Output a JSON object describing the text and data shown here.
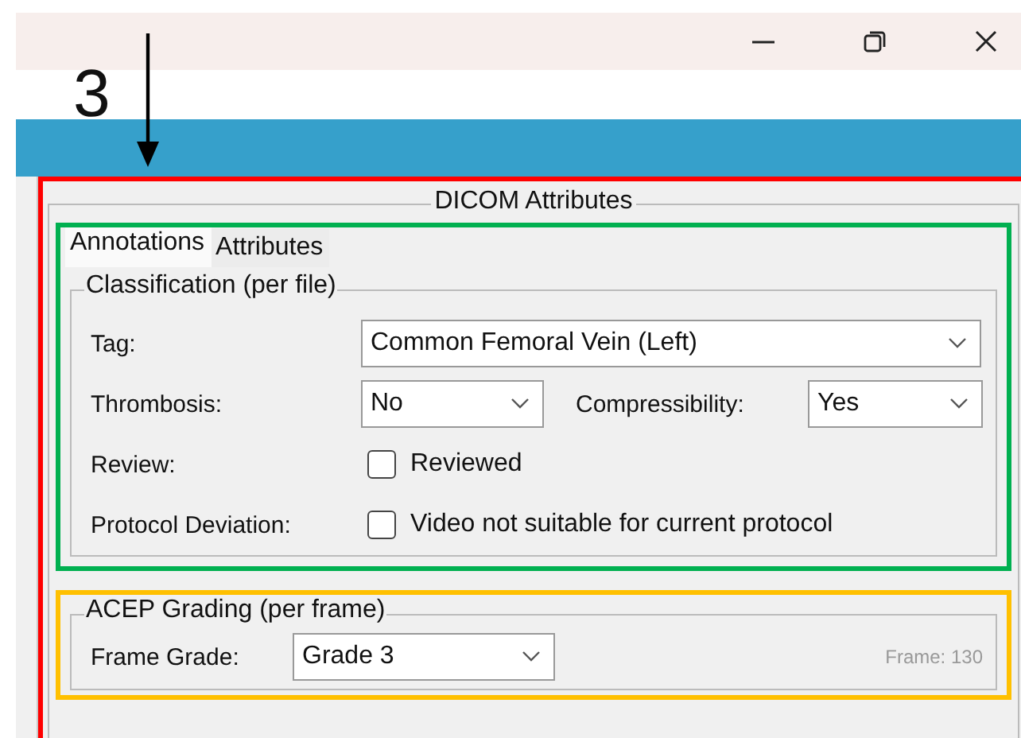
{
  "callout": {
    "label": "3"
  },
  "window": {
    "controls": [
      {
        "kind": "minimize"
      },
      {
        "kind": "restore"
      },
      {
        "kind": "close"
      }
    ]
  },
  "panel": {
    "title": "DICOM Attributes",
    "tabs": [
      {
        "label": "Annotations",
        "selected": true
      },
      {
        "label": "Attributes",
        "selected": false
      }
    ],
    "classification": {
      "title": "Classification (per file)",
      "tag": {
        "label": "Tag:",
        "value": "Common Femoral Vein (Left)"
      },
      "thrombosis": {
        "label": "Thrombosis:",
        "value": "No"
      },
      "compressibility": {
        "label": "Compressibility:",
        "value": "Yes"
      },
      "checks": [
        {
          "label": "Review:",
          "text": "Reviewed",
          "checked": false
        },
        {
          "label": "Protocol Deviation:",
          "text": "Video not suitable for current protocol",
          "checked": false
        }
      ]
    },
    "grading": {
      "title": "ACEP Grading (per frame)",
      "label": "Frame Grade:",
      "value": "Grade 3",
      "frame": "Frame: 130"
    }
  }
}
